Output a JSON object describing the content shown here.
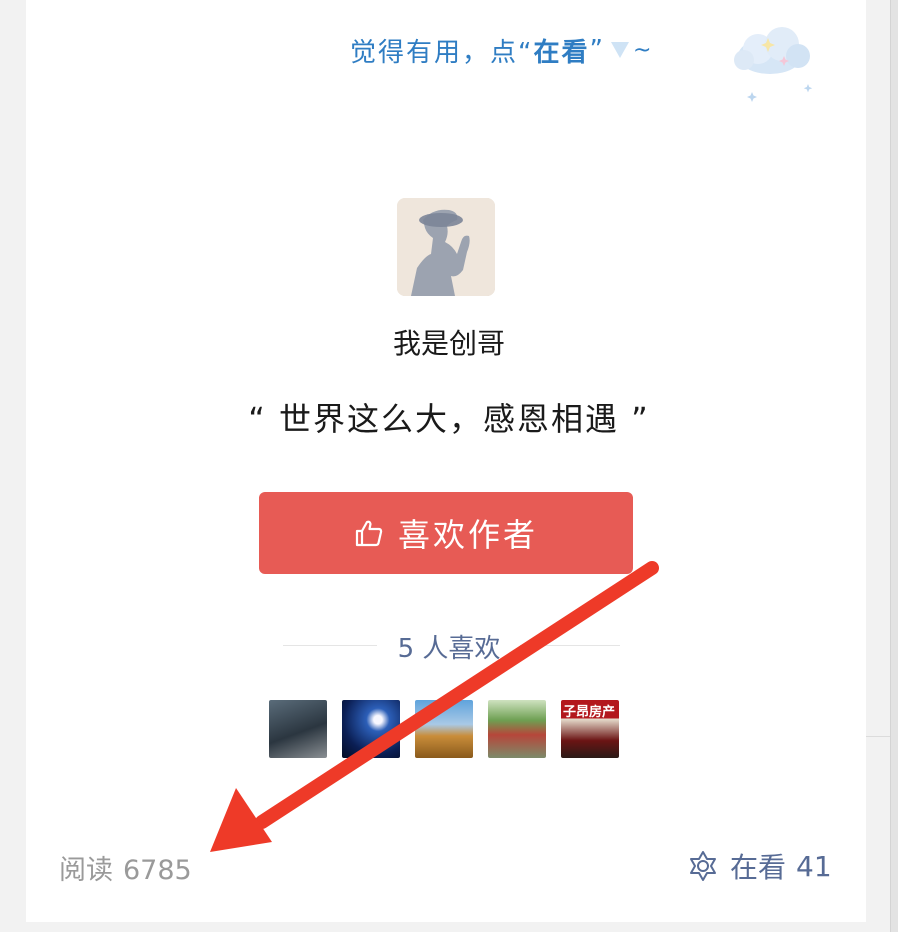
{
  "hint": {
    "prefix": "觉得有用，点“",
    "emphasis": "在看",
    "suffix": "”",
    "tilde": "~",
    "cloud_icon": "cloud-sparkle-icon",
    "color": "#2f7dc3"
  },
  "author": {
    "avatar_icon": "silhouette-avatar",
    "name": "我是创哥",
    "quote": "“ 世界这么大，感恩相遇 ”"
  },
  "like_button": {
    "label": "喜欢作者",
    "icon": "thumbs-up-icon",
    "color": "#e75b55"
  },
  "likes": {
    "count_text": "5 人喜欢",
    "link_color": "#576b95",
    "avatars": [
      {
        "name": "liker-avatar-1",
        "text": ""
      },
      {
        "name": "liker-avatar-2",
        "text": ""
      },
      {
        "name": "liker-avatar-3",
        "text": ""
      },
      {
        "name": "liker-avatar-4",
        "text": ""
      },
      {
        "name": "liker-avatar-5",
        "text": "子昂房产"
      }
    ]
  },
  "footer": {
    "reads_label": "阅读",
    "reads_count": "6785",
    "watching_label": "在看",
    "watching_count": "41",
    "watching_icon": "flower-star-icon"
  },
  "annotation": {
    "type": "arrow",
    "color": "#ee3a28",
    "points_to": "reads-count"
  }
}
